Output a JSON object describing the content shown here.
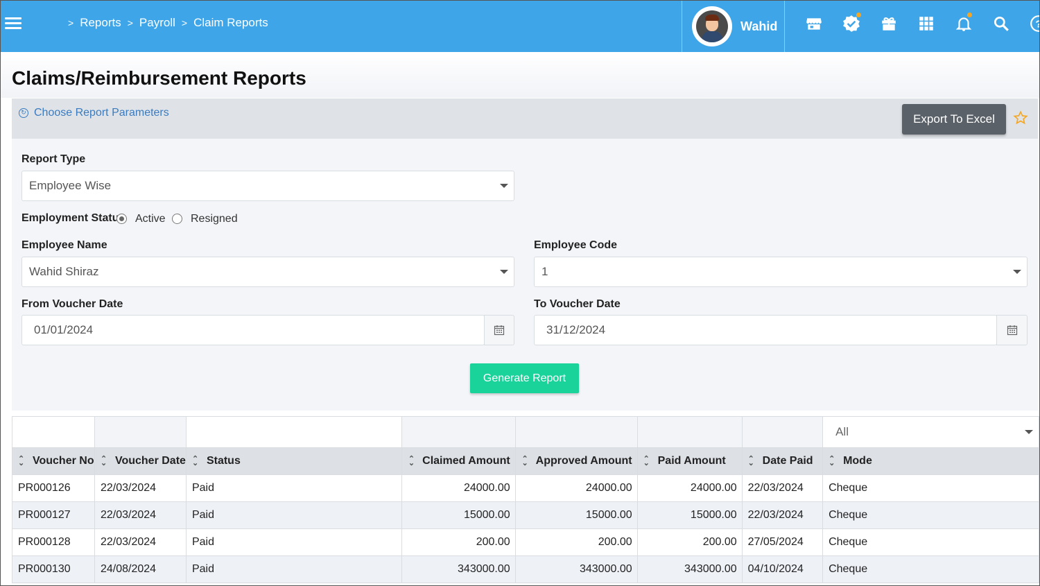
{
  "breadcrumb": [
    "Reports",
    "Payroll",
    "Claim Reports"
  ],
  "user": {
    "name": "Wahid"
  },
  "header_icons": [
    "store-icon",
    "verified-badge-icon",
    "gift-icon",
    "apps-grid-icon",
    "bell-icon",
    "search-icon",
    "help-icon"
  ],
  "page_title": "Claims/Reimbursement Reports",
  "params_link": "Choose Report Parameters",
  "export_label": "Export To Excel",
  "form": {
    "report_type_label": "Report Type",
    "report_type_value": "Employee Wise",
    "employment_status_label": "Employment Status",
    "status_options": [
      "Active",
      "Resigned"
    ],
    "status_selected": "Active",
    "employee_name_label": "Employee Name",
    "employee_name_value": "Wahid Shiraz",
    "employee_code_label": "Employee Code",
    "employee_code_value": "1",
    "from_date_label": "From Voucher Date",
    "from_date_value": "01/01/2024",
    "to_date_label": "To Voucher Date",
    "to_date_value": "31/12/2024",
    "generate_label": "Generate Report"
  },
  "table": {
    "mode_filter": "All",
    "columns": [
      "Voucher No",
      "Voucher Date",
      "Status",
      "Claimed Amount",
      "Approved Amount",
      "Paid Amount",
      "Date Paid",
      "Mode"
    ],
    "rows": [
      [
        "PR000126",
        "22/03/2024",
        "Paid",
        "24000.00",
        "24000.00",
        "24000.00",
        "22/03/2024",
        "Cheque"
      ],
      [
        "PR000127",
        "22/03/2024",
        "Paid",
        "15000.00",
        "15000.00",
        "15000.00",
        "22/03/2024",
        "Cheque"
      ],
      [
        "PR000128",
        "22/03/2024",
        "Paid",
        "200.00",
        "200.00",
        "200.00",
        "27/05/2024",
        "Cheque"
      ],
      [
        "PR000130",
        "24/08/2024",
        "Paid",
        "343000.00",
        "343000.00",
        "343000.00",
        "04/10/2024",
        "Cheque"
      ]
    ]
  },
  "colors": {
    "header_bg": "#3ea6e8",
    "accent_green": "#19d39a",
    "export_bg": "#5b6168",
    "star": "#f5a623"
  }
}
